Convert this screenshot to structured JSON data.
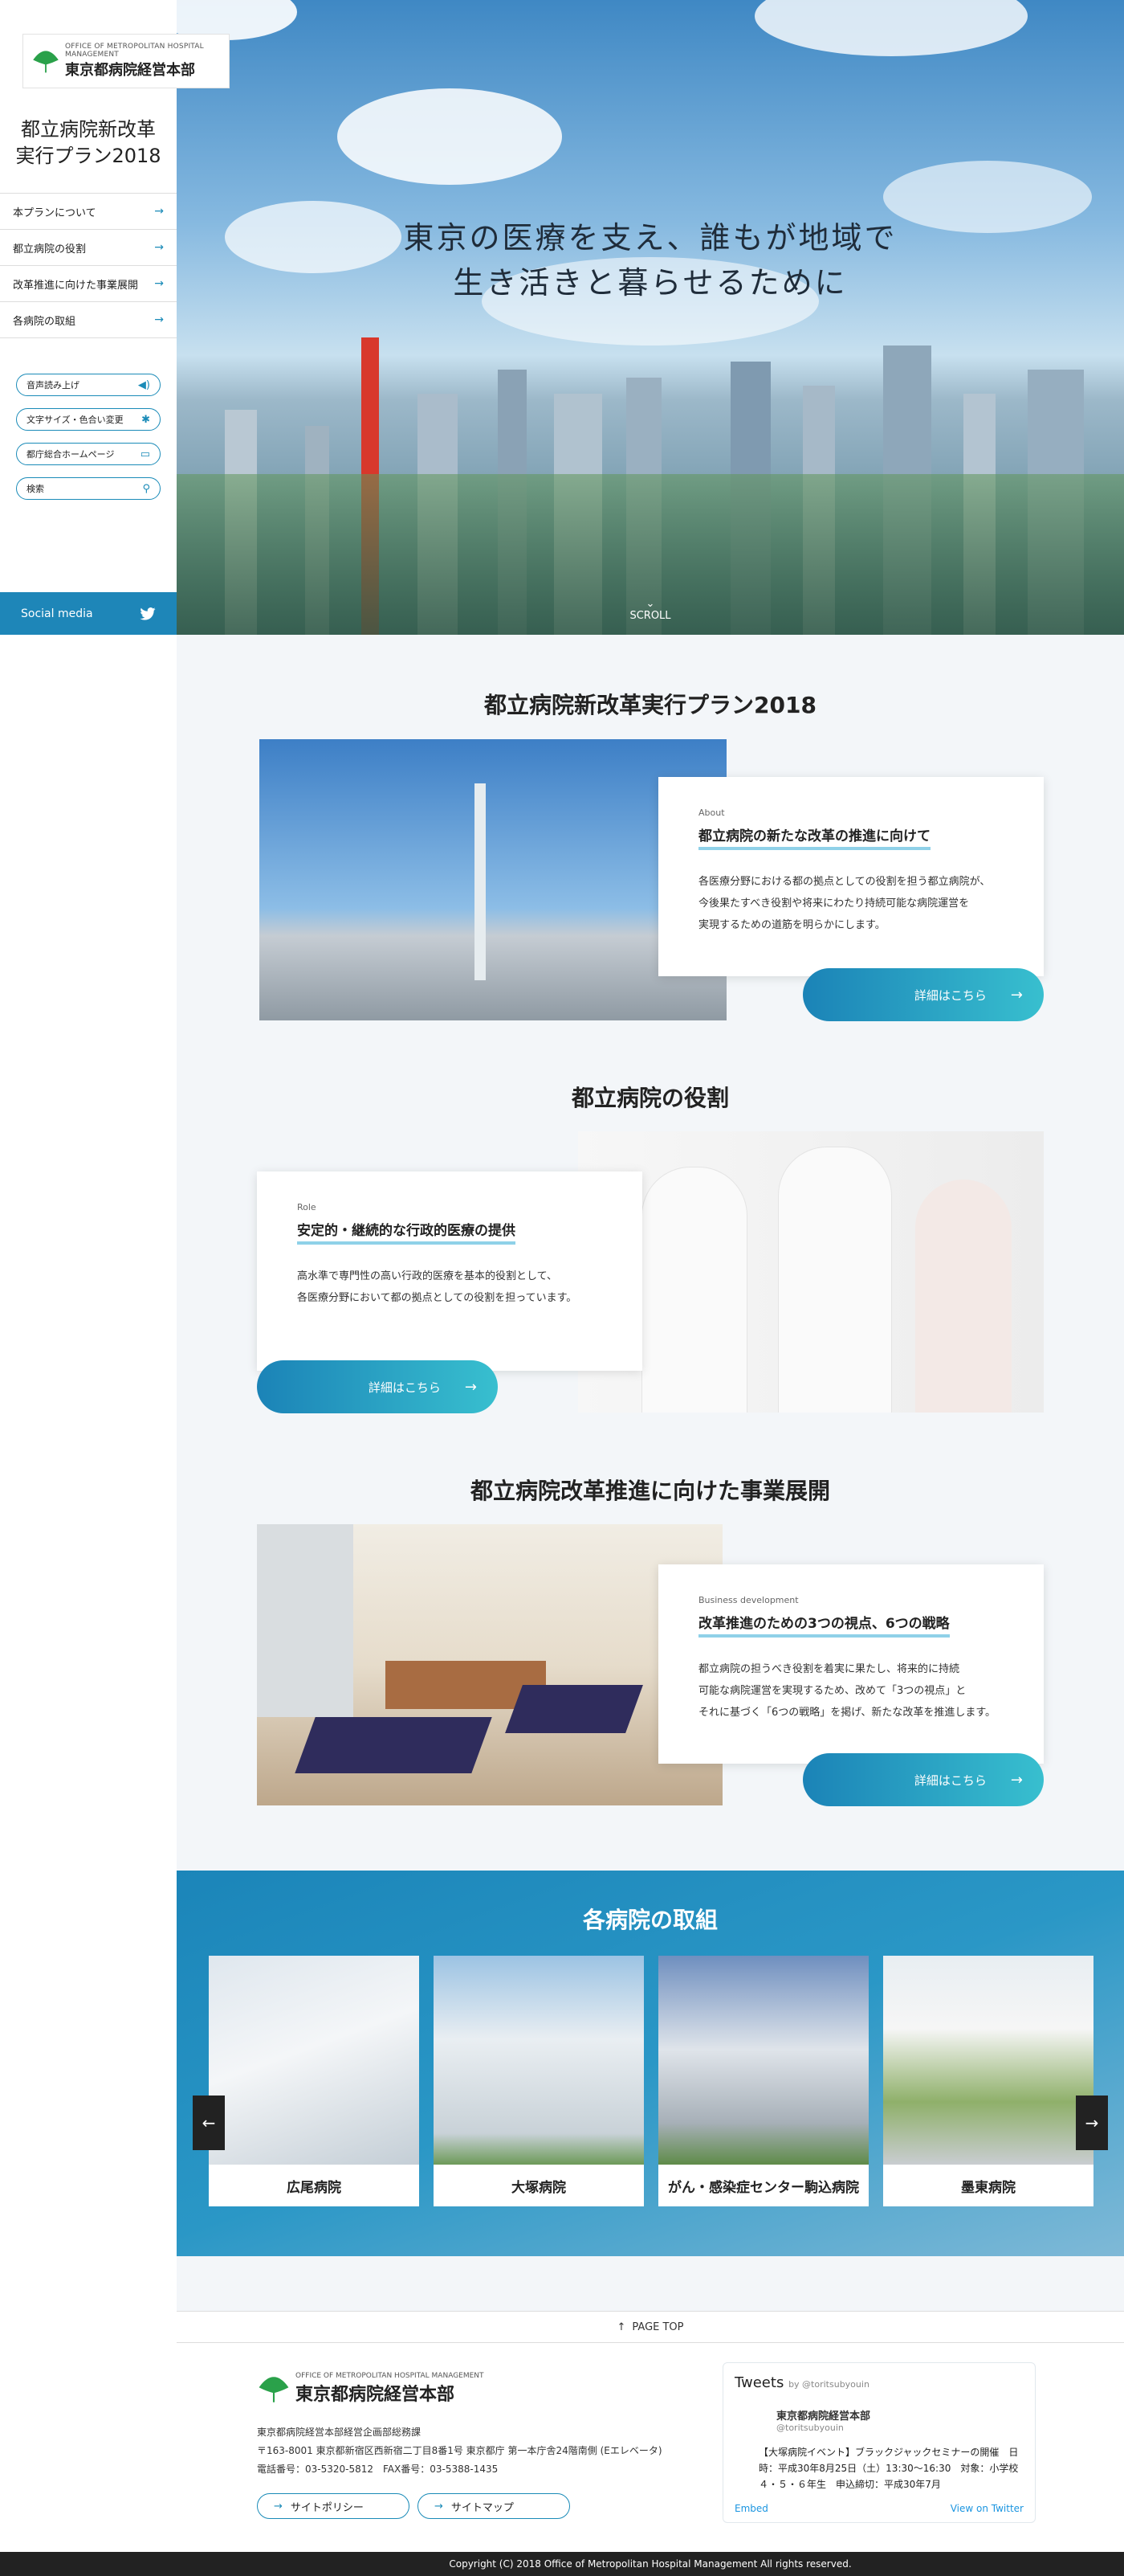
{
  "brand": {
    "logo_en": "OFFICE OF METROPOLITAN HOSPITAL MANAGEMENT",
    "logo_ja": "東京都病院経営本部",
    "plan_title_line1": "都立病院新改革",
    "plan_title_line2": "実行プラン2018"
  },
  "nav": {
    "items": [
      {
        "label": "本プランについて"
      },
      {
        "label": "都立病院の役割"
      },
      {
        "label": "改革推進に向けた事業展開"
      },
      {
        "label": "各病院の取組"
      }
    ]
  },
  "tools": {
    "read_aloud": "音声読み上げ",
    "text_size": "文字サイズ・色合い変更",
    "gov_home": "都庁総合ホームページ",
    "search_placeholder": "検索"
  },
  "social": {
    "label": "Social media"
  },
  "hero": {
    "line1": "東京の医療を支え、誰もが地域で",
    "line2": "生き活きと暮らせるために",
    "scroll": "SCROLL"
  },
  "sections": [
    {
      "title": "都立病院新改革実行プラン2018",
      "label": "About",
      "heading": "都立病院の新たな改革の推進に向けて",
      "body": [
        "各医療分野における都の拠点としての役割を担う都立病院が、",
        "今後果たすべき役割や将来にわたり持続可能な病院運営を",
        "実現するための道筋を明らかにします。"
      ],
      "more": "詳細はこちら"
    },
    {
      "title": "都立病院の役割",
      "label": "Role",
      "heading": "安定的・継続的な行政的医療の提供",
      "body": [
        "高水準で専門性の高い行政的医療を基本的役割として、",
        "各医療分野において都の拠点としての役割を担っています。"
      ],
      "more": "詳細はこちら"
    },
    {
      "title": "都立病院改革推進に向けた事業展開",
      "label": "Business development",
      "heading": "改革推進のための3つの視点、6つの戦略",
      "body": [
        "都立病院の担うべき役割を着実に果たし、将来的に持続",
        "可能な病院運営を実現するため、改めて「3つの視点」と",
        "それに基づく「6つの戦略」を掲げ、新たな改革を推進します。"
      ],
      "more": "詳細はこちら"
    }
  ],
  "hospitals": {
    "title": "各病院の取組",
    "items": [
      {
        "name": "広尾病院"
      },
      {
        "name": "大塚病院"
      },
      {
        "name": "がん・感染症センター駒込病院"
      },
      {
        "name": "墨東病院"
      }
    ]
  },
  "pagetop": "PAGE TOP",
  "footer": {
    "org": "東京都病院経営本部経営企画部総務課",
    "address": "〒163-8001 東京都新宿区西新宿二丁目8番1号 東京都庁 第一本庁舎24階南側 (Eエレベータ)",
    "phone": "電話番号：03-5320-5812　FAX番号：03-5388-1435",
    "policy": "サイトポリシー",
    "sitemap": "サイトマップ"
  },
  "tweets": {
    "title": "Tweets",
    "by": "by @toritsubyouin",
    "account": "東京都病院経営本部",
    "handle": "@toritsubyouin",
    "text": "【大塚病院イベント】ブラックジャックセミナーの開催　日時：平成30年8月25日（土）13:30〜16:30　対象：小学校４・５・６年生　申込締切：平成30年7月",
    "embed": "Embed",
    "view": "View on Twitter"
  },
  "copyright": "Copyright (C) 2018 Office of Metropolitan Hospital Management All rights reserved."
}
